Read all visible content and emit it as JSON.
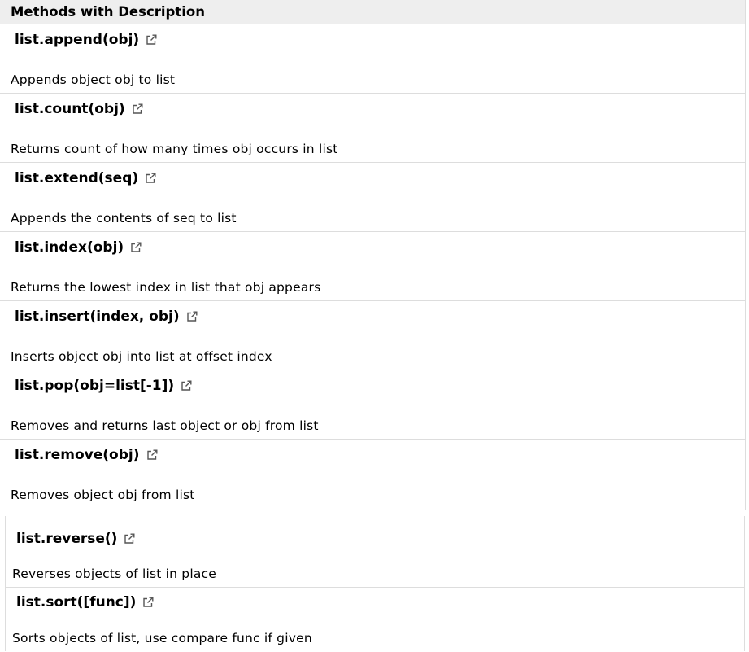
{
  "table": {
    "header": "Methods with Description",
    "rows_a": [
      {
        "name": "list.append(obj)",
        "description": "Appends object obj to list",
        "icon": "external-link-icon"
      },
      {
        "name": "list.count(obj)",
        "description": "Returns count of how many times obj occurs in list",
        "icon": "external-link-icon"
      },
      {
        "name": "list.extend(seq)",
        "description": "Appends the contents of seq to list",
        "icon": "external-link-icon"
      },
      {
        "name": "list.index(obj)",
        "description": "Returns the lowest index in list that obj appears",
        "icon": "external-link-icon"
      },
      {
        "name": "list.insert(index, obj)",
        "description": "Inserts object obj into list at offset index",
        "icon": "external-link-icon"
      },
      {
        "name": "list.pop(obj=list[-1])",
        "description": "Removes and returns last object or obj from list",
        "icon": "external-link-icon"
      },
      {
        "name": "list.remove(obj)",
        "description": "Removes object obj from list",
        "icon": "external-link-icon"
      }
    ],
    "rows_b": [
      {
        "name": "list.reverse()",
        "description": "Reverses objects of list in place",
        "icon": "external-link-icon"
      },
      {
        "name": "list.sort([func])",
        "description": "Sorts objects of list, use compare func if given",
        "icon": "external-link-icon"
      }
    ]
  },
  "colors": {
    "header_bg": "#eeeeee",
    "border": "#dddddd",
    "text": "#000000",
    "icon": "#555555"
  }
}
